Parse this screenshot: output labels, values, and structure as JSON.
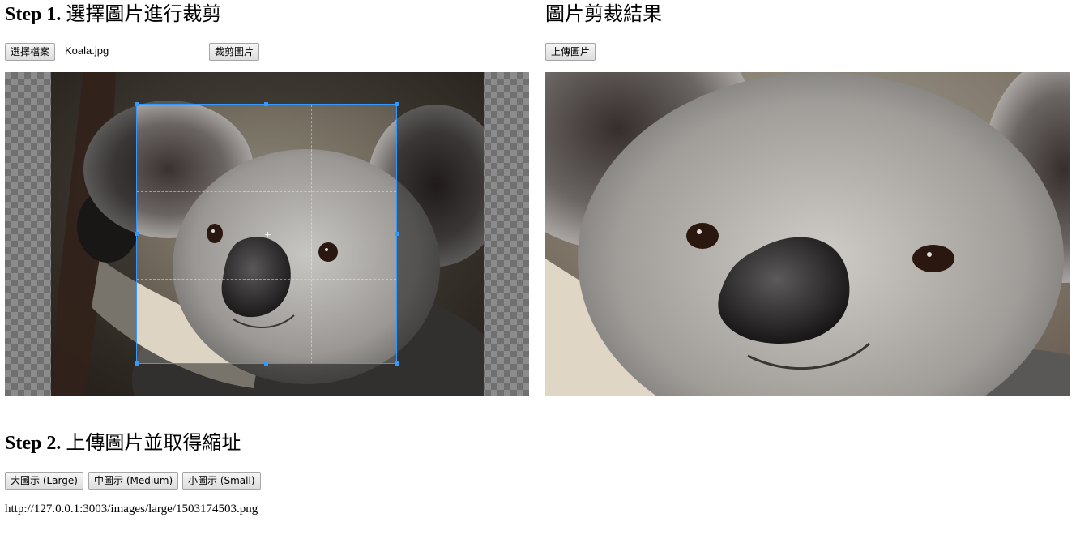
{
  "step1": {
    "title_bold": "Step 1.",
    "title_rest": " 選擇圖片進行裁剪",
    "choose_file_label": "選擇檔案",
    "file_name": "Koala.jpg",
    "crop_button_label": "裁剪圖片"
  },
  "result": {
    "title": "圖片剪裁結果",
    "upload_button_label": "上傳圖片"
  },
  "step2": {
    "title_bold": "Step 2.",
    "title_rest": " 上傳圖片並取得縮址",
    "buttons": [
      {
        "label": "大圖示 (Large)"
      },
      {
        "label": "中圖示 (Medium)"
      },
      {
        "label": "小圖示 (Small)"
      }
    ],
    "url": "http://127.0.0.1:3003/images/large/1503174503.png"
  },
  "colors": {
    "crop_border": "#3399ff",
    "checker_dark": "#cccccc"
  },
  "icons": [
    "koala-photo",
    "cropped-koala-photo",
    "crop-handle",
    "crop-center-cross"
  ]
}
